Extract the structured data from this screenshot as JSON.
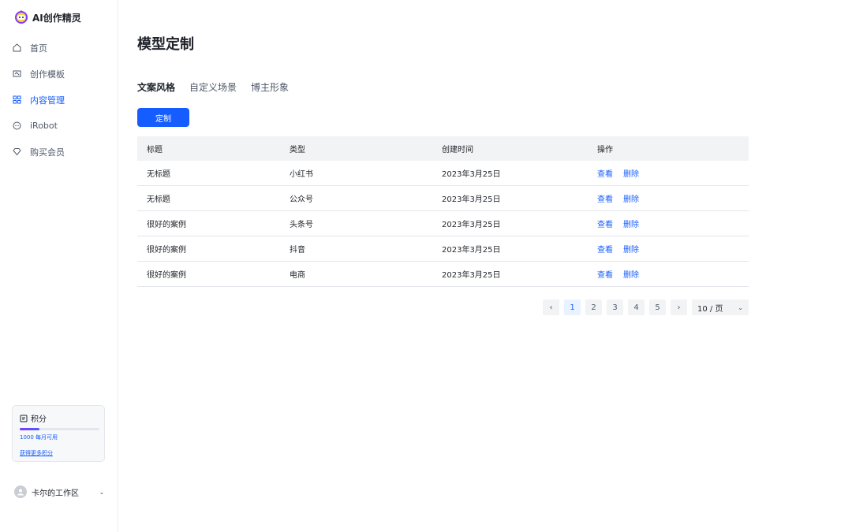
{
  "brand": {
    "name": "AI创作精灵"
  },
  "nav": [
    {
      "label": "首页"
    },
    {
      "label": "创作模板"
    },
    {
      "label": "内容管理"
    },
    {
      "label": "iRobot"
    },
    {
      "label": "购买会员"
    }
  ],
  "points": {
    "title": "积分",
    "usage": "1000 每月可用",
    "progress_fraction": 0.25,
    "link": "获得更多积分"
  },
  "workspace": {
    "name": "卡尔的工作区"
  },
  "page": {
    "title": "模型定制"
  },
  "tabs": [
    {
      "label": "文案风格"
    },
    {
      "label": "自定义场景"
    },
    {
      "label": "博主形象"
    }
  ],
  "actions": {
    "custom_label": "定制"
  },
  "table": {
    "headers": [
      "标题",
      "类型",
      "创建时间",
      "操作"
    ],
    "rows": [
      {
        "title": "无标题",
        "type": "小红书",
        "created": "2023年3月25日"
      },
      {
        "title": "无标题",
        "type": "公众号",
        "created": "2023年3月25日"
      },
      {
        "title": "很好的案例",
        "type": "头条号",
        "created": "2023年3月25日"
      },
      {
        "title": "很好的案例",
        "type": "抖音",
        "created": "2023年3月25日"
      },
      {
        "title": "很好的案例",
        "type": "电商",
        "created": "2023年3月25日"
      }
    ],
    "ops": {
      "view": "查看",
      "delete": "删除"
    }
  },
  "pagination": {
    "prev": "‹",
    "next": "›",
    "pages": [
      "1",
      "2",
      "3",
      "4",
      "5"
    ],
    "current": "1",
    "page_size": "10 / 页"
  },
  "colors": {
    "accent": "#165dff",
    "header_bg": "#f2f3f5"
  }
}
